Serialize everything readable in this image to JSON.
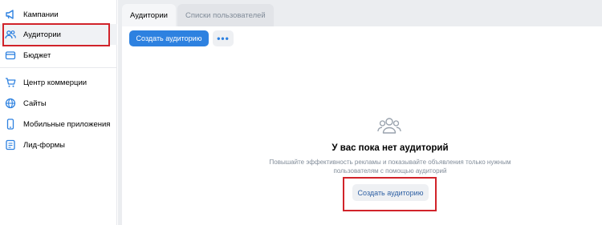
{
  "sidebar": {
    "items": [
      {
        "label": "Кампании",
        "icon": "megaphone-icon"
      },
      {
        "label": "Аудитории",
        "icon": "users-icon"
      },
      {
        "label": "Бюджет",
        "icon": "wallet-icon"
      },
      {
        "label": "Центр коммерции",
        "icon": "cart-icon"
      },
      {
        "label": "Сайты",
        "icon": "globe-icon"
      },
      {
        "label": "Мобильные приложения",
        "icon": "phone-icon"
      },
      {
        "label": "Лид-формы",
        "icon": "form-icon"
      }
    ]
  },
  "tabs": [
    {
      "label": "Аудитории",
      "active": true
    },
    {
      "label": "Списки пользователей",
      "active": false
    }
  ],
  "toolbar": {
    "create_label": "Создать аудиторию",
    "more_label": "•••"
  },
  "empty_state": {
    "icon": "users-icon",
    "title": "У вас пока нет аудиторий",
    "description": "Повышайте эффективность рекламы и показывайте объявления только нужным пользователям с помощью аудиторий",
    "button_label": "Создать аудиторию"
  },
  "colors": {
    "accent": "#2d81e0",
    "highlight": "#d1232a",
    "background": "#ebedf0"
  }
}
